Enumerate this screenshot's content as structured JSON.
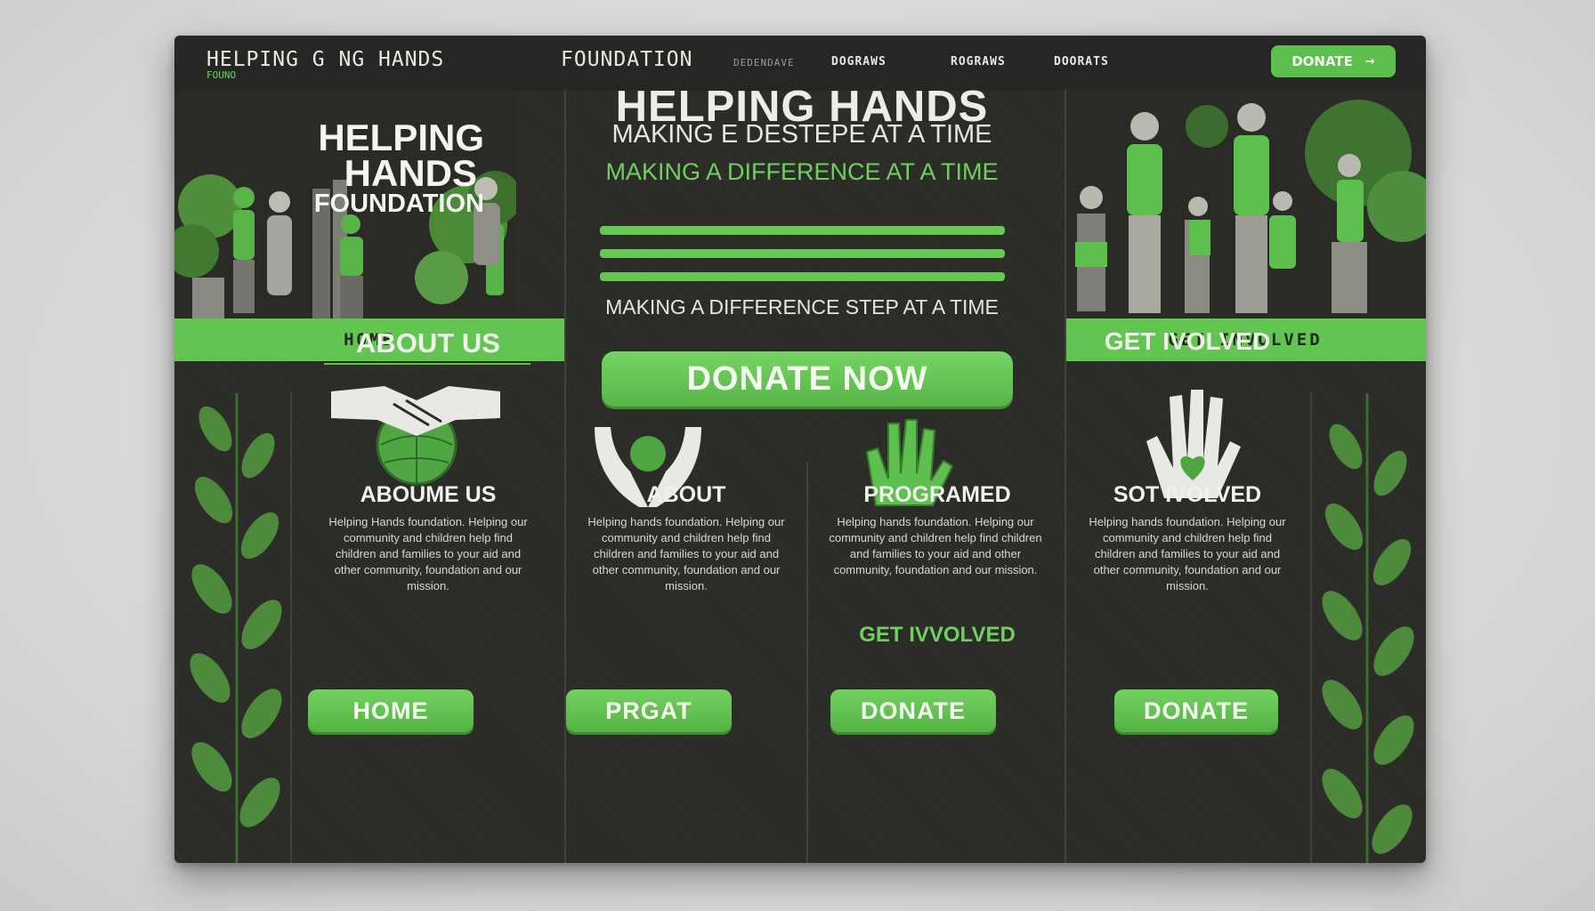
{
  "header": {
    "brand": "HELPING G NG HANDS",
    "brand_sub": "FOUNO",
    "foundation": "FOUNDATION",
    "nav": [
      "DOGRAWS",
      "ROGRAWS",
      "DOORATS"
    ],
    "nav_dim": "DEDENDAVE",
    "donate": "DONATE",
    "donate_arrow": "→"
  },
  "left_hero": {
    "title_line1": "HELPING",
    "title_line2": "HANDS",
    "title_line3": "FOUNDATION",
    "band": "HOME"
  },
  "center_hero": {
    "title": "HELPING HANDS",
    "sub1": "MAKING E DESTEPE AT A TIME",
    "sub2": "MAKING A DIFFERENCE AT A TIME",
    "sub3": "MAKING A DIFFERENCE STEP AT A TIME",
    "donate_now": "DONATE NOW"
  },
  "right_hero": {
    "band": "GET INVOLVED"
  },
  "columns": [
    {
      "top_heading": "ABOUT US",
      "heading": "ABOUME US",
      "icon": "handshake-globe-icon",
      "text": "Helping Hands foundation. Helping our community and children help find children and families to your aid and other community, foundation and our mission.",
      "small": "",
      "button": "HOME"
    },
    {
      "heading": "ABOUT",
      "icon": "open-hands-icon",
      "text": "Helping hands foundation. Helping our community and children help find children and families to your aid and other community, foundation and our mission.",
      "small": "",
      "button": "PRGAT"
    },
    {
      "heading": "PROGRAMED",
      "icon": "raised-hand-icon",
      "text": "Helping hands foundation. Helping our community and children help find children and families to your aid and other community, foundation and our mission.",
      "sub_heading": "GET IVVOLVED",
      "small": "",
      "button": "DONATE"
    },
    {
      "top_heading": "GET IVOLVED",
      "heading": "SOT IVOLVED",
      "icon": "heart-hand-icon",
      "text": "Helping hands foundation. Helping our community and children help find children and families to your aid and other community, foundation and our mission.",
      "small": "",
      "button": "DONATE"
    }
  ],
  "colors": {
    "accent": "#62c552",
    "background": "#2b2c28",
    "page": "#dcdcda"
  }
}
